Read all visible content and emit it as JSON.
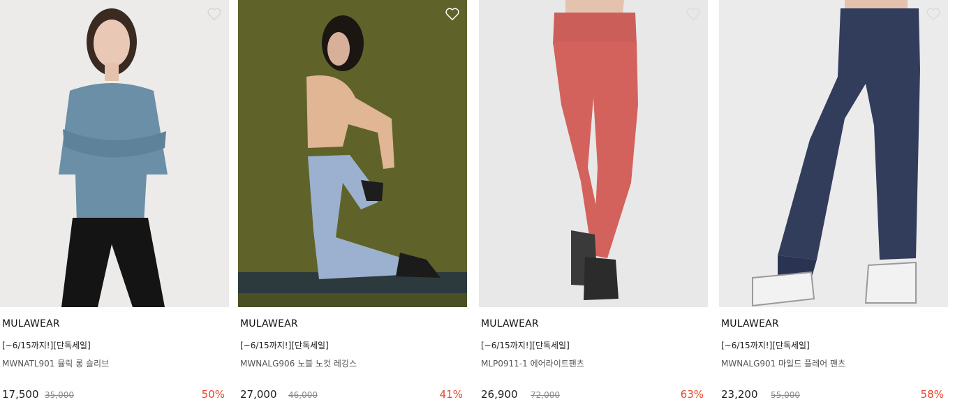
{
  "products": [
    {
      "brand": "MULAWEAR",
      "promo": "[~6/15까지!][단독세일]",
      "name": "MWNATL901 뮬릭 롱 슬리브",
      "price": "17,500",
      "original_price": "35,000",
      "discount": "50%",
      "image_bg": "#ecebea"
    },
    {
      "brand": "MULAWEAR",
      "promo": "[~6/15까지!][단독세일]",
      "name": "MWNALG906 노블 노컷 레깅스",
      "price": "27,000",
      "original_price": "46,000",
      "discount": "41%",
      "image_bg": "#5f6329"
    },
    {
      "brand": "MULAWEAR",
      "promo": "[~6/15까지!][단독세일]",
      "name": "MLP0911-1 에어라이트팬츠",
      "price": "26,900",
      "original_price": "72,000",
      "discount": "63%",
      "image_bg": "#e8e8e8"
    },
    {
      "brand": "MULAWEAR",
      "promo": "[~6/15까지!][단독세일]",
      "name": "MWNALG901 마일드 플레어 팬츠",
      "price": "23,200",
      "original_price": "55,000",
      "discount": "58%",
      "image_bg": "#ebebeb"
    }
  ],
  "icons": {
    "wishlist": "heart-outline-icon"
  },
  "colors": {
    "discount": "#e8452c",
    "text": "#111111",
    "muted": "#888888"
  }
}
